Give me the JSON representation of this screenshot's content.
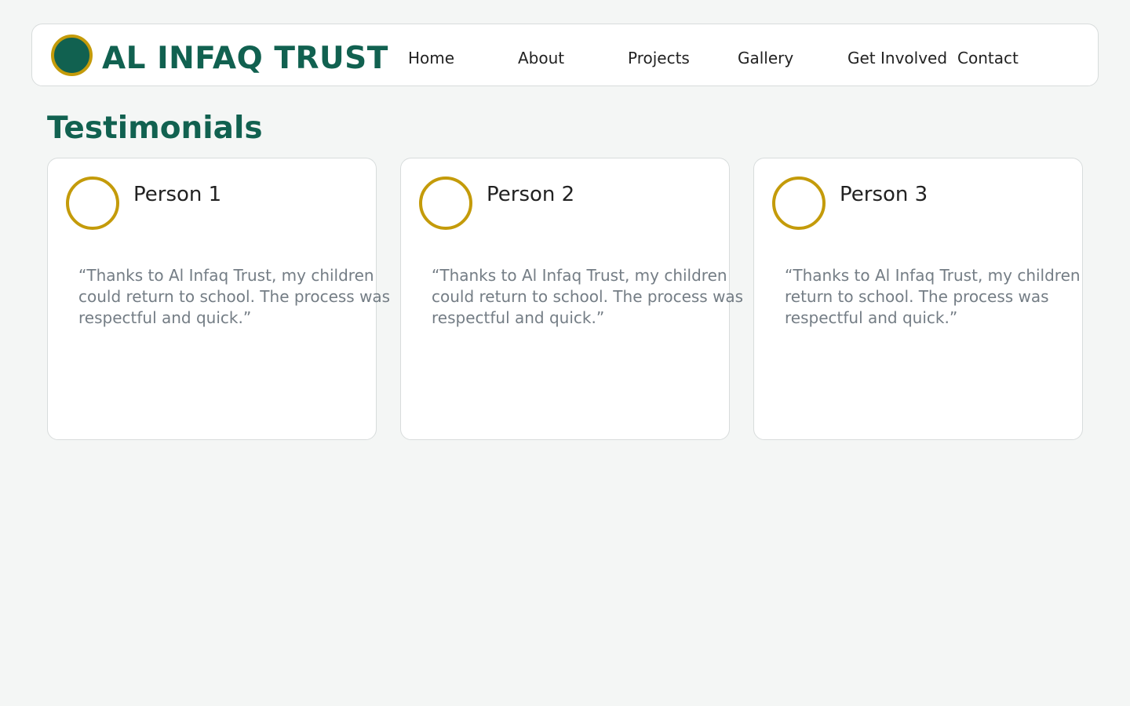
{
  "brand": {
    "name": "AL INFAQ TRUST",
    "logo_icon": "circle-emblem-icon",
    "primary_color": "#116150",
    "accent_color": "#c49b0a"
  },
  "nav": {
    "items": [
      {
        "label": "Home"
      },
      {
        "label": "About"
      },
      {
        "label": "Projects"
      },
      {
        "label": "Gallery"
      },
      {
        "label": "Get Involved"
      },
      {
        "label": "Contact"
      }
    ]
  },
  "testimonials": {
    "title": "Testimonials",
    "items": [
      {
        "name": "Person 1",
        "avatar_icon": "avatar-ring-icon",
        "quote": "“Thanks to Al Infaq Trust, my children could return to school. The process was respectful and quick.”"
      },
      {
        "name": "Person 2",
        "avatar_icon": "avatar-ring-icon",
        "quote": "“Thanks to Al Infaq Trust, my children could return to school. The process was respectful and quick.”"
      },
      {
        "name": "Person 3",
        "avatar_icon": "avatar-ring-icon",
        "quote": "“Thanks to Al Infaq Trust, my children could return to school. The process was respectful and quick.”"
      }
    ]
  }
}
